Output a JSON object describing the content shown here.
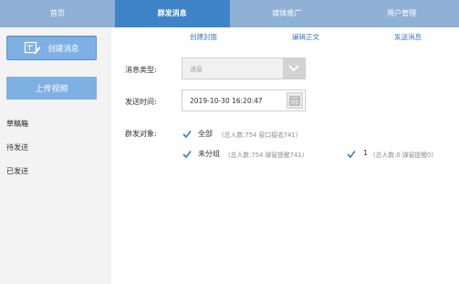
{
  "nav": {
    "tabs": [
      {
        "label": "首页"
      },
      {
        "label": "群发消息"
      },
      {
        "label": "媒体推广"
      },
      {
        "label": "用户管理"
      }
    ],
    "active_index": 1
  },
  "sidebar": {
    "create_label": "创建消息",
    "upload_label": "上传视频",
    "items": [
      {
        "label": "草稿箱"
      },
      {
        "label": "待发送"
      },
      {
        "label": "已发送"
      }
    ]
  },
  "sublinks": {
    "create_cover": "创建封面",
    "edit_body": "编辑正文",
    "send_message": "发送消息"
  },
  "form": {
    "type_label": "消息类型:",
    "type_value": "消息",
    "time_label": "发送时间:",
    "time_value": "2019-10-30 16:20:47",
    "target_label": "群发对象:",
    "options": [
      {
        "label": "全部",
        "detail": "(总人数:754 窗口接收741)",
        "checked": true
      },
      {
        "label": "未分组",
        "detail": "(总人数:754 弹窗提醒741)",
        "checked": true
      },
      {
        "label": "1",
        "detail": "(总人数:0 弹窗提醒0)",
        "checked": true
      }
    ]
  },
  "colors": {
    "nav_bg": "#8fb1d6",
    "nav_active": "#3f84c9",
    "accent": "#3a79c0",
    "button": "#7fb0e3"
  }
}
